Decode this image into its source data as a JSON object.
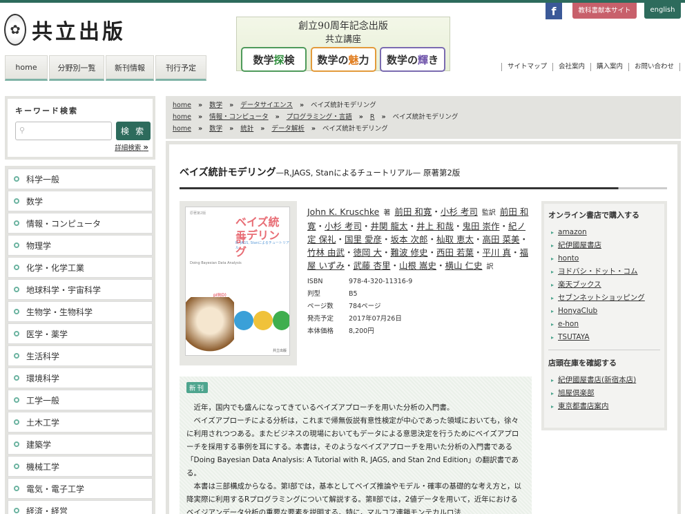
{
  "brand": {
    "logo_text": "共立出版",
    "seal_icon": "seal-icon"
  },
  "banner": {
    "line1": "創立90周年記念出版",
    "line2": "共立講座",
    "boxes": [
      {
        "pre": "数学",
        "mid": "探",
        "post": "検"
      },
      {
        "pre": "数学の",
        "mid": "魅",
        "post": "力"
      },
      {
        "pre": "数学の",
        "mid": "輝",
        "post": "き"
      }
    ]
  },
  "top_buttons": {
    "facebook": "f",
    "textbook": "教科書献本サイト",
    "english": "english"
  },
  "nav": {
    "tabs": [
      "home",
      "分野別一覧",
      "新刊情報",
      "刊行予定"
    ]
  },
  "util_links": [
    "サイトマップ",
    "会社案内",
    "購入案内",
    "お問い合わせ"
  ],
  "search": {
    "title": "キーワード検索",
    "button": "検 索",
    "advanced": "詳細検索",
    "advanced_arrow": "»",
    "value": ""
  },
  "categories": [
    "科学一般",
    "数学",
    "情報・コンピュータ",
    "物理学",
    "化学・化学工業",
    "地球科学・宇宙科学",
    "生物学・生物科学",
    "医学・薬学",
    "生活科学",
    "環境科学",
    "工学一般",
    "土木工学",
    "建築学",
    "機械工学",
    "電気・電子工学",
    "経済・経営"
  ],
  "breadcrumbs": [
    [
      "home",
      "数学",
      "データサイエンス",
      "ベイズ統計モデリング"
    ],
    [
      "home",
      "情報・コンピュータ",
      "プログラミング・言語",
      "R",
      "ベイズ統計モデリング"
    ],
    [
      "home",
      "数学",
      "統計",
      "データ解析",
      "ベイズ統計モデリング"
    ]
  ],
  "book": {
    "title": "ベイズ統計モデリング",
    "subtitle": "—R,JAGS, Stanによるチュートリアル— 原著第2版",
    "cover": {
      "edition_tag": "原著第2版",
      "title1": "ベイズ統計",
      "title2": "モデリング",
      "subtitle": "R, JAGS, Stanによるチュートリアル",
      "english": "Doing Bayesian Data Analysis",
      "formula": "p(θ|D)",
      "publisher": "共立出版"
    },
    "author_main": "John K. Kruschke",
    "role_author": "著",
    "supervisors": [
      "前田 和寛",
      "小杉 考司"
    ],
    "role_supervisor": "監訳",
    "translators": [
      "前田 和寛",
      "小杉 考司",
      "井関 龍太",
      "井上 和哉",
      "鬼田 崇作",
      "紀ノ定 保礼",
      "国里 愛彦",
      "坂本 次郎",
      "杣取 恵太",
      "高田 菜美",
      "竹林 由武",
      "徳岡 大",
      "難波 修史",
      "西田 若葉",
      "平川 真",
      "福屋 いずみ",
      "武藤 杏里",
      "山根 嵩史",
      "横山 仁史"
    ],
    "role_translator": "訳",
    "specs": [
      {
        "key": "ISBN",
        "value": "978-4-320-11316-9"
      },
      {
        "key": "判型",
        "value": "B5"
      },
      {
        "key": "ページ数",
        "value": "784ページ"
      },
      {
        "key": "発売予定",
        "value": "2017年07月26日"
      },
      {
        "key": "本体価格",
        "value": "8,200円"
      }
    ],
    "badge": "新刊",
    "description": [
      "近年，国内でも盛んになってきているベイズアプローチを用いた分析の入門書。",
      "ベイズアプローチによる分析は，これまで帰無仮説有意性検定が中心であった領域においても，徐々に利用されつつある。またビジネスの現場においてもデータによる意思決定を行うためにベイズアプローチを採用する事例を耳にする。本書は，そのようなベイズアプローチを用いた分析の入門書である「Doing Bayesian Data Analysis: A Tutorial with R, JAGS, and Stan 2nd Edition」の翻訳書である。",
      "本書は三部構成からなる。第Ⅰ部では，基本としてベイズ推論やモデル・確率の基礎的な考え方と，以降実際に利用するRプログラミングについて解説する。第Ⅱ部では，2値データを用いて，近年におけるベイジアンデータ分析の重要な要素を説明する。特に，マルコフ連鎖モンテカルロ法"
    ]
  },
  "online_shops": {
    "heading": "オンライン書店で購入する",
    "items": [
      "amazon",
      "紀伊國屋書店",
      "honto",
      "ヨドバシ・ドット・コム",
      "楽天ブックス",
      "セブンネットショッピング",
      "HonyaClub",
      "e-hon",
      "TSUTAYA"
    ]
  },
  "store_stock": {
    "heading": "店頭在庫を確認する",
    "items": [
      "紀伊國屋書店(新宿本店)",
      "旭屋倶楽部",
      "東京都書店案内"
    ]
  },
  "colors": {
    "accent": "#2d6b5c",
    "textbook_button": "#c8606b",
    "facebook": "#3b5998",
    "badge": "#4ea58e"
  }
}
